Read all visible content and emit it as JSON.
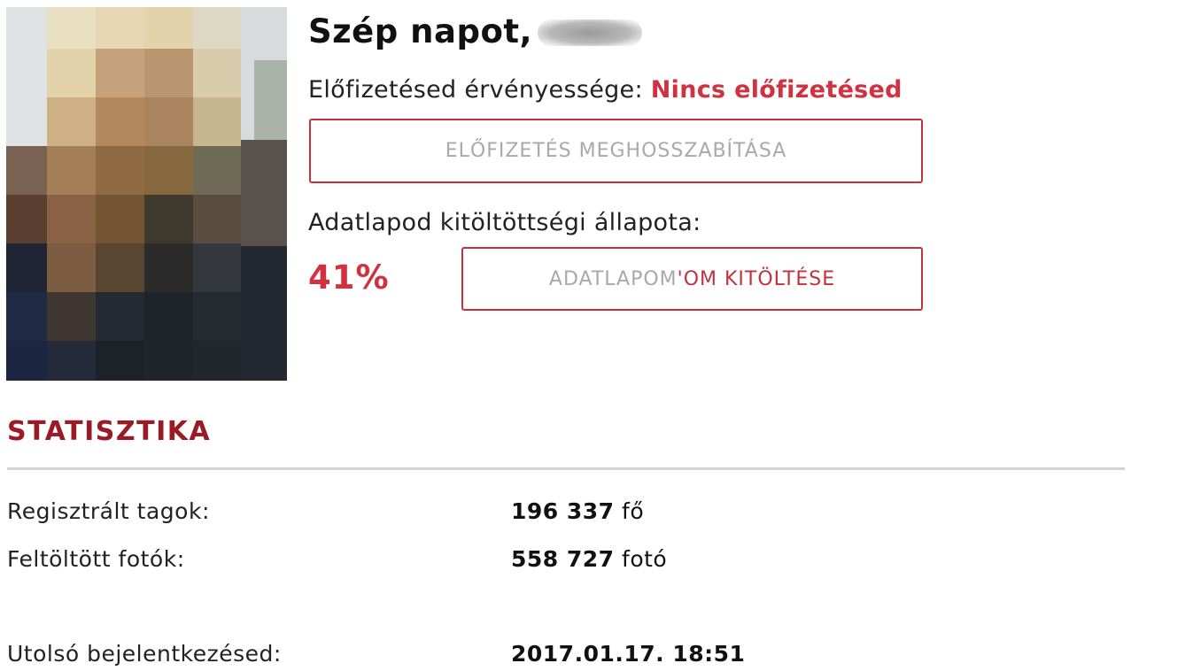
{
  "greeting": {
    "text": "Szép napot,"
  },
  "subscription": {
    "label": "Előfizetésed érvényessége:",
    "status": "Nincs előfizetésed",
    "status_color": "#d0323f",
    "renew_button": "ELŐFIZETÉS MEGHOSSZABÍTÁSA"
  },
  "profile": {
    "label": "Adatlapod kitöltöttségi állapota:",
    "percent": "41%",
    "completion": 0.41,
    "button_left": "ADATLAPOM",
    "button_right": "'OM KITÖLTÉSE"
  },
  "stats": {
    "title": "STATISZTIKA",
    "rows": [
      {
        "label": "Regisztrált tagok:",
        "value": "196 337",
        "unit": "fő"
      },
      {
        "label": "Feltöltött fotók:",
        "value": "558 727",
        "unit": "fotó"
      },
      {
        "label": "Utolsó bejelentkezésed:",
        "value": "2017.01.17. 18:51",
        "unit": ""
      }
    ]
  },
  "colors": {
    "accent": "#d0323f",
    "section_title": "#9a1b25",
    "button_border": "#c2313d"
  }
}
